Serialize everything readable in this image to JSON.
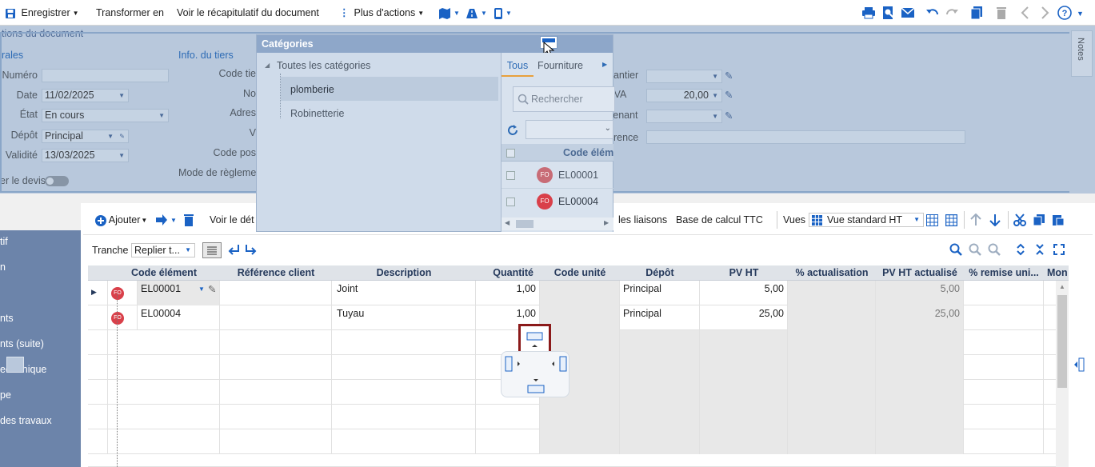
{
  "toolbar": {
    "save": "Enregistrer",
    "transform": "Transformer en",
    "summary": "Voir le récapitulatif du document",
    "more": "Plus d'actions"
  },
  "header": {
    "title": "tions du document",
    "section_general": "rales",
    "section_third": "Info. du tiers",
    "notes": "Notes",
    "labels": {
      "numero": "Numéro",
      "date": "Date",
      "etat": "État",
      "depot": "Dépôt",
      "validite": "Validité",
      "code_tiers": "Code tie",
      "nom": "No",
      "adresse": "Adres",
      "ville": "V",
      "code_postal": "Code pos",
      "mode_reglement": "Mode de règleme",
      "chantier": "hantier",
      "tva": "TVA",
      "intervenant": "venant",
      "reference": "érence",
      "toggle": "er le devis"
    },
    "values": {
      "date": "11/02/2025",
      "etat": "En cours",
      "depot": "Principal",
      "validite": "13/03/2025",
      "tva": "20,00"
    }
  },
  "categories": {
    "title": "Catégories",
    "tree": {
      "root": "Toutes les catégories",
      "children": [
        "plomberie",
        "Robinetterie"
      ]
    },
    "tabs": [
      "Tous",
      "Fourniture"
    ],
    "search_placeholder": "Rechercher",
    "column_header": "Code élém",
    "items": [
      {
        "badge": "FO",
        "code": "EL00001"
      },
      {
        "badge": "FO",
        "code": "EL00004"
      }
    ]
  },
  "nav": {
    "items": [
      "tif",
      "n",
      "nts",
      "nts (suite)",
      "ectronique",
      "pe",
      "des travaux"
    ]
  },
  "body_toolbar": {
    "add": "Ajouter",
    "detail": "Voir le dét",
    "links": "les liaisons",
    "ttc": "Base de calcul TTC",
    "views_label": "Vues",
    "views_value": "Vue standard HT",
    "tranche_label": "Tranche",
    "tranche_value": "Replier t..."
  },
  "grid": {
    "columns": [
      "Code élément",
      "Référence client",
      "Description",
      "Quantité",
      "Code unité",
      "Dépôt",
      "PV HT",
      "% actualisation",
      "PV HT actualisé",
      "% remise uni...",
      "Mon"
    ],
    "rows": [
      {
        "badge": "FO",
        "code": "EL00001",
        "description": "Joint",
        "quantite": "1,00",
        "depot": "Principal",
        "pvht": "5,00",
        "pvht_act": "5,00"
      },
      {
        "badge": "FO",
        "code": "EL00004",
        "description": "Tuyau",
        "quantite": "1,00",
        "depot": "Principal",
        "pvht": "25,00",
        "pvht_act": "25,00"
      }
    ]
  },
  "colors": {
    "accent": "#1a62c4",
    "nav_bg": "#6c84aa",
    "badge": "#d9404a",
    "overlay": "#b8c8dc"
  }
}
